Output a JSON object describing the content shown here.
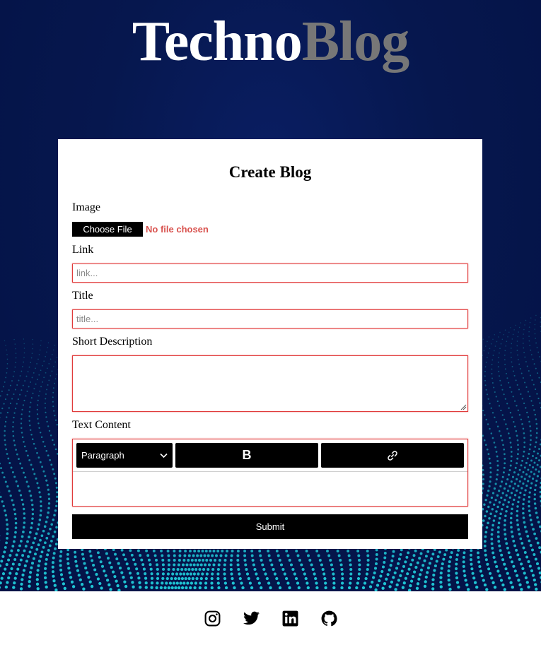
{
  "header": {
    "logo_part1": "Techno",
    "logo_part2": "Blog"
  },
  "form": {
    "title": "Create Blog",
    "image_label": "Image",
    "file_button_label": "Choose File",
    "file_status": "No file chosen",
    "link_label": "Link",
    "link_placeholder": "link...",
    "title_label": "Title",
    "title_placeholder": "title...",
    "short_description_label": "Short Description",
    "text_content_label": "Text Content",
    "editor": {
      "block_format": "Paragraph",
      "bold_label": "B"
    },
    "submit_label": "Submit"
  },
  "footer": {
    "icons": [
      "instagram-icon",
      "twitter-icon",
      "linkedin-icon",
      "github-icon"
    ]
  },
  "colors": {
    "background": "#06174e",
    "accent_dots": "#1fc7d6",
    "input_border": "#e03a3a",
    "file_status": "#d9534f"
  }
}
